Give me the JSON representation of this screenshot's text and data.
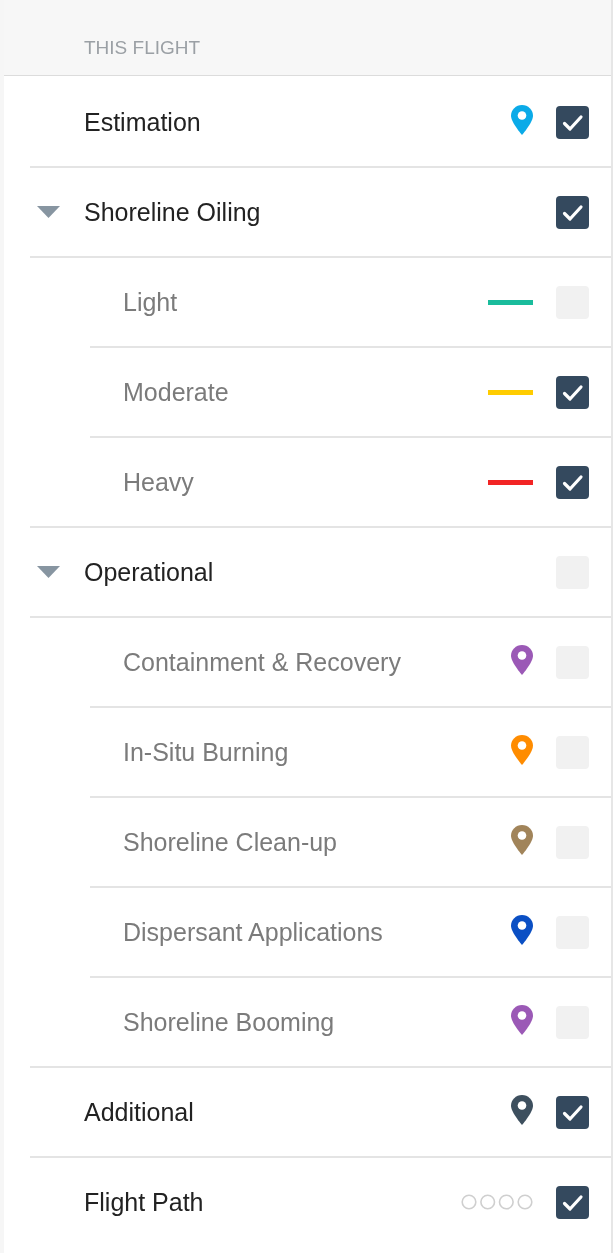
{
  "section": {
    "title": "THIS FLIGHT"
  },
  "layers": [
    {
      "label": "Estimation",
      "kind": "pin",
      "color": "#0aaae8",
      "checked": true
    },
    {
      "label": "Shoreline Oiling",
      "kind": "group",
      "expanded": true,
      "checked": true,
      "children": [
        {
          "label": "Light",
          "kind": "line",
          "color": "#1abc9c",
          "checked": false
        },
        {
          "label": "Moderate",
          "kind": "line",
          "color": "#ffcc00",
          "checked": true
        },
        {
          "label": "Heavy",
          "kind": "line",
          "color": "#f22424",
          "checked": true
        }
      ]
    },
    {
      "label": "Operational",
      "kind": "group",
      "expanded": true,
      "checked": false,
      "children": [
        {
          "label": "Containment & Recovery",
          "kind": "pin",
          "color": "#9b59b6",
          "checked": false
        },
        {
          "label": "In-Situ Burning",
          "kind": "pin",
          "color": "#ff8c00",
          "checked": false
        },
        {
          "label": "Shoreline Clean-up",
          "kind": "pin",
          "color": "#a1845a",
          "checked": false
        },
        {
          "label": "Dispersant Applications",
          "kind": "pin",
          "color": "#0a4fc4",
          "checked": false
        },
        {
          "label": "Shoreline Booming",
          "kind": "pin",
          "color": "#9b59b6",
          "checked": false
        }
      ]
    },
    {
      "label": "Additional",
      "kind": "pin",
      "color": "#3d4f5e",
      "checked": true
    },
    {
      "label": "Flight Path",
      "kind": "track",
      "checked": true
    }
  ]
}
